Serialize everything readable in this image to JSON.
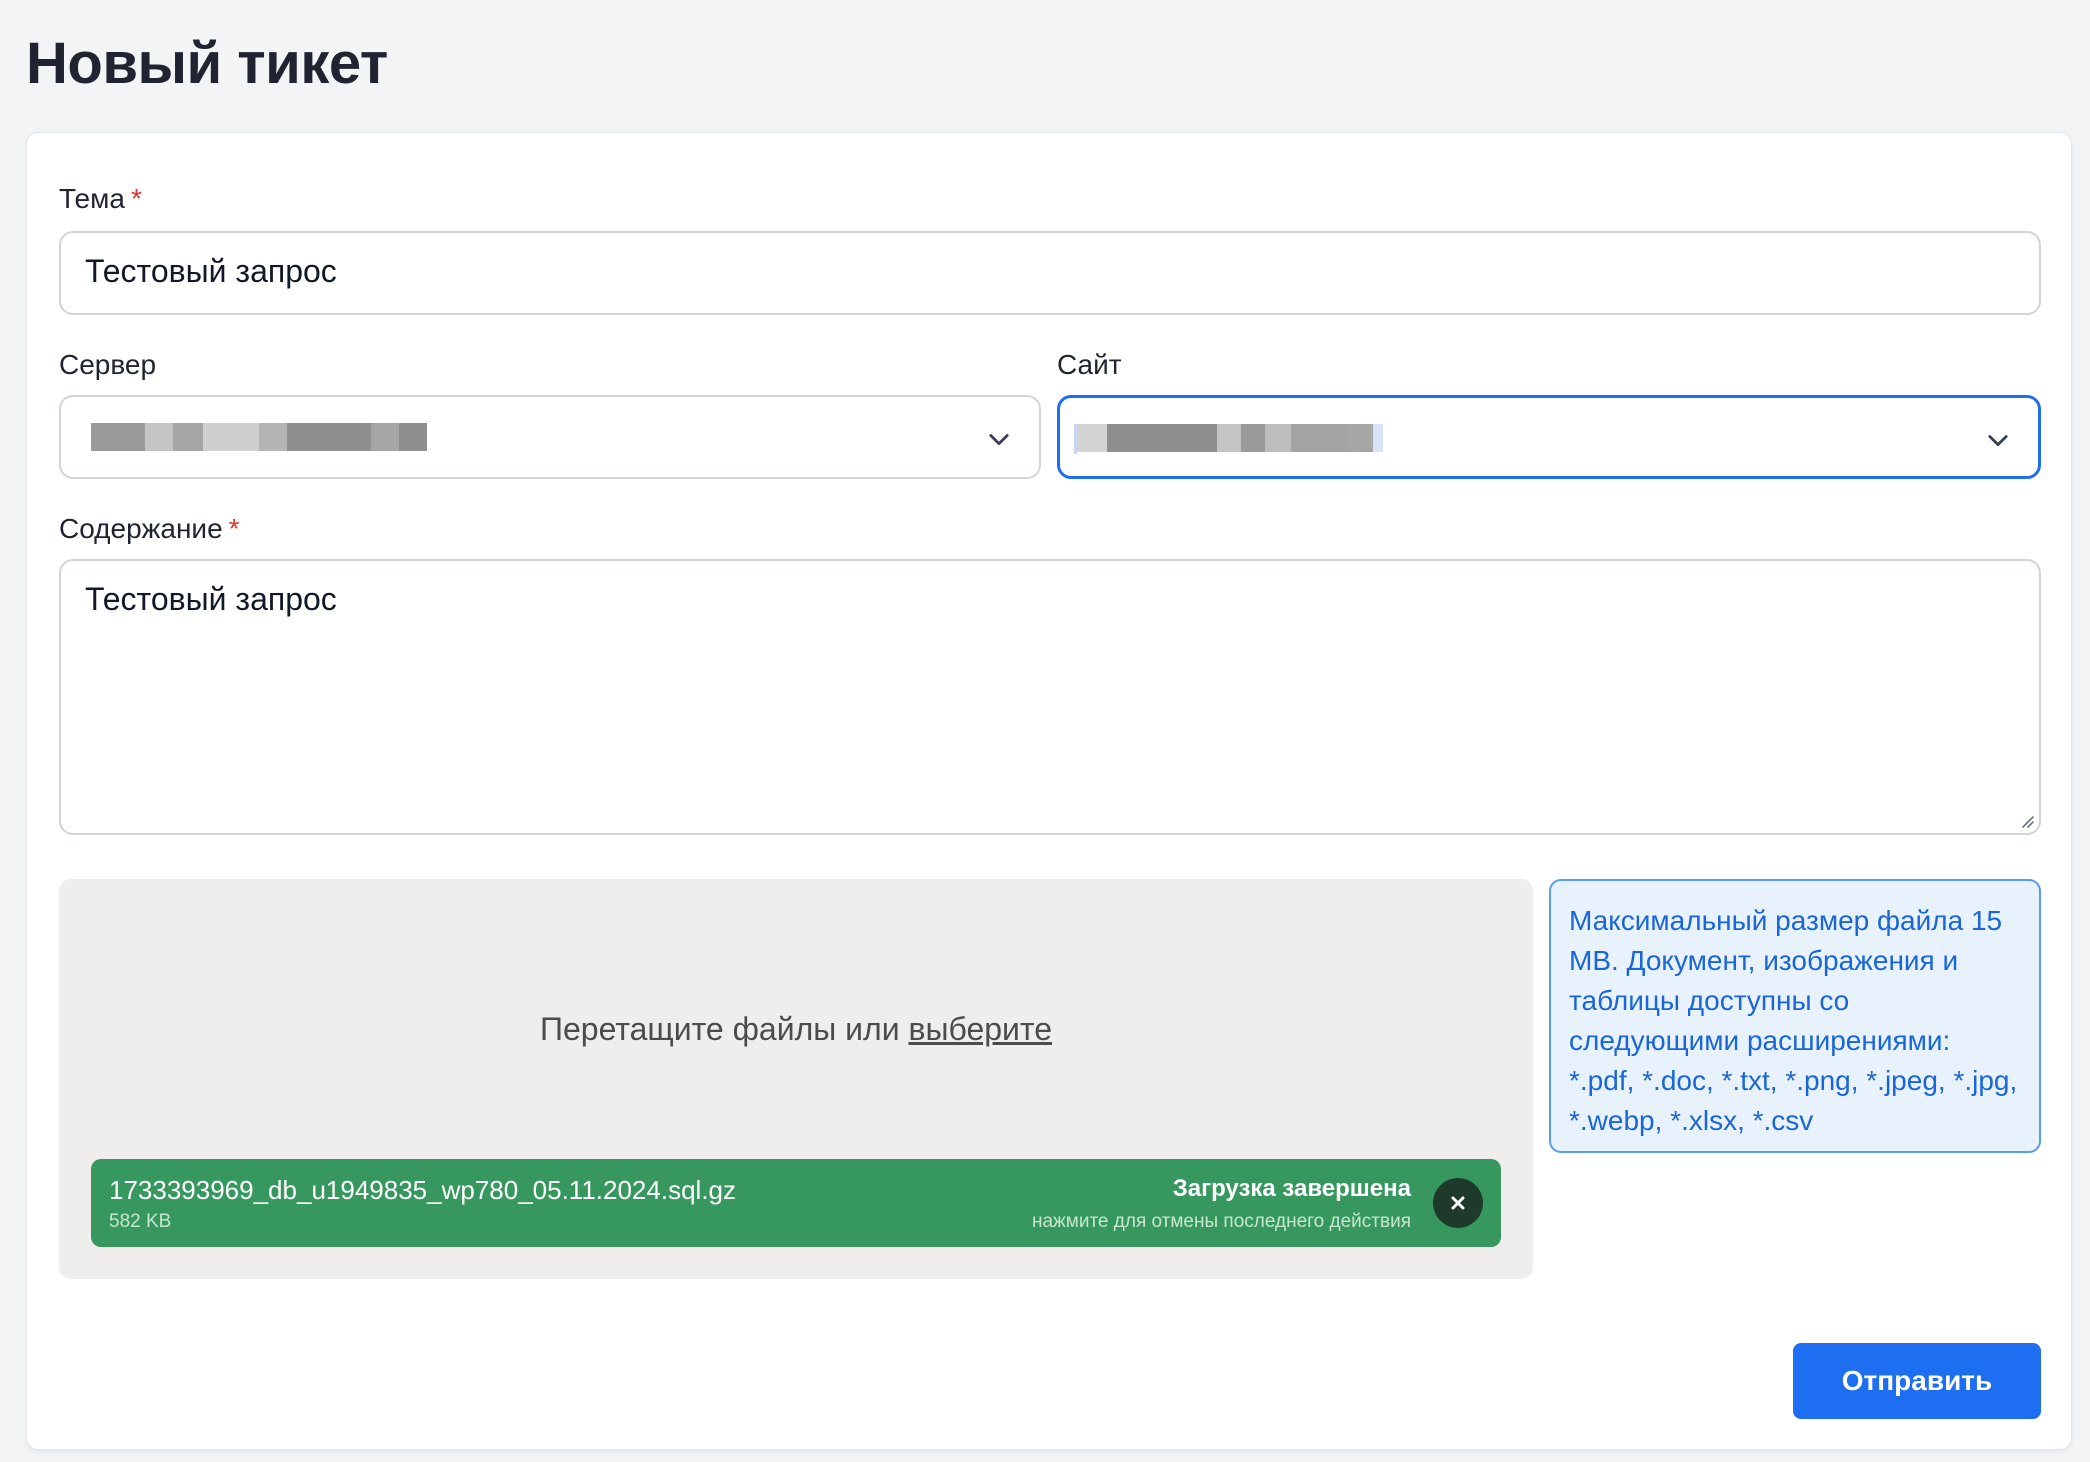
{
  "page": {
    "title": "Новый тикет"
  },
  "form": {
    "subject": {
      "label": "Тема",
      "required_mark": "*",
      "value": "Тестовый запрос"
    },
    "server": {
      "label": "Сервер",
      "value_redacted": true
    },
    "site": {
      "label": "Сайт",
      "value_redacted": true,
      "focused": true
    },
    "content": {
      "label": "Содержание",
      "required_mark": "*",
      "value": "Тестовый запрос"
    },
    "dropzone": {
      "text": "Перетащите файлы или",
      "link": "выберите"
    },
    "file": {
      "name": "1733393969_db_u1949835_wp780_05.11.2024.sql.gz",
      "size": "582 KB",
      "status": "Загрузка завершена",
      "hint": "нажмите для отмены последнего действия"
    },
    "info": "Максимальный размер файла 15 MB. Документ, изображения и таблицы доступны со следующими расширениями: *.pdf, *.doc, *.txt, *.png, *.jpeg, *.jpg, *.webp, *.xlsx, *.csv",
    "submit_label": "Отправить"
  },
  "colors": {
    "accent": "#1d6ef0",
    "success": "#37985f",
    "required": "#e5312e",
    "info_text": "#1a66d6",
    "info_bg": "#e8f2fd"
  },
  "icons": [
    "chevron-down-icon",
    "close-icon",
    "resize-handle-icon"
  ]
}
